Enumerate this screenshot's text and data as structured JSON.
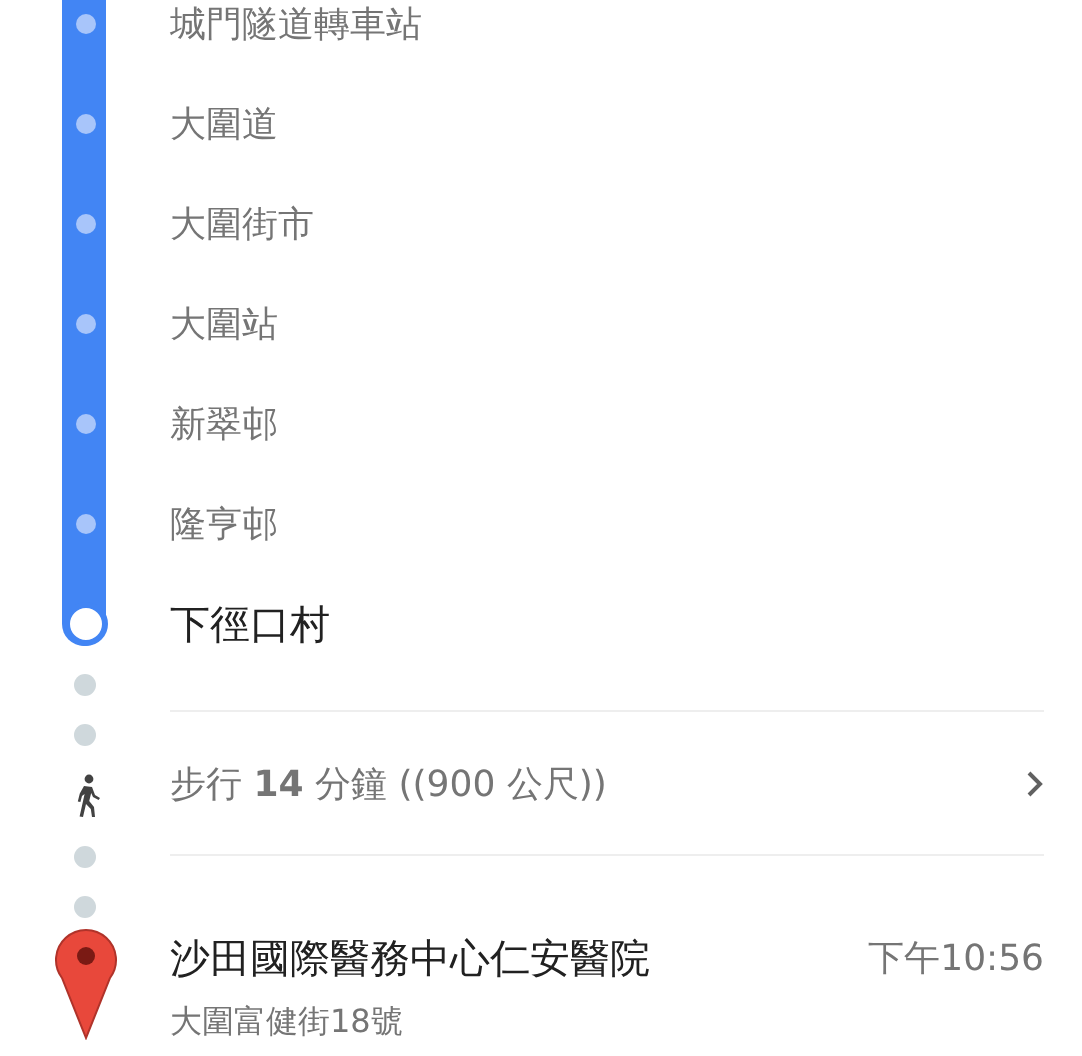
{
  "transit_stops": [
    {
      "name": "城門隧道轉車站",
      "kind": "intermediate"
    },
    {
      "name": "大圍道",
      "kind": "intermediate"
    },
    {
      "name": "大圍街市",
      "kind": "intermediate"
    },
    {
      "name": "大圍站",
      "kind": "intermediate"
    },
    {
      "name": "新翠邨",
      "kind": "intermediate"
    },
    {
      "name": "隆亨邨",
      "kind": "intermediate"
    },
    {
      "name": "下徑口村",
      "kind": "terminal"
    }
  ],
  "walk": {
    "text": "步行 **14** 分鐘 ((900 公尺))"
  },
  "destination": {
    "name": "沙田國際醫務中心仁安醫院",
    "time": "下午10:56",
    "address": "大圍富健街18號"
  }
}
